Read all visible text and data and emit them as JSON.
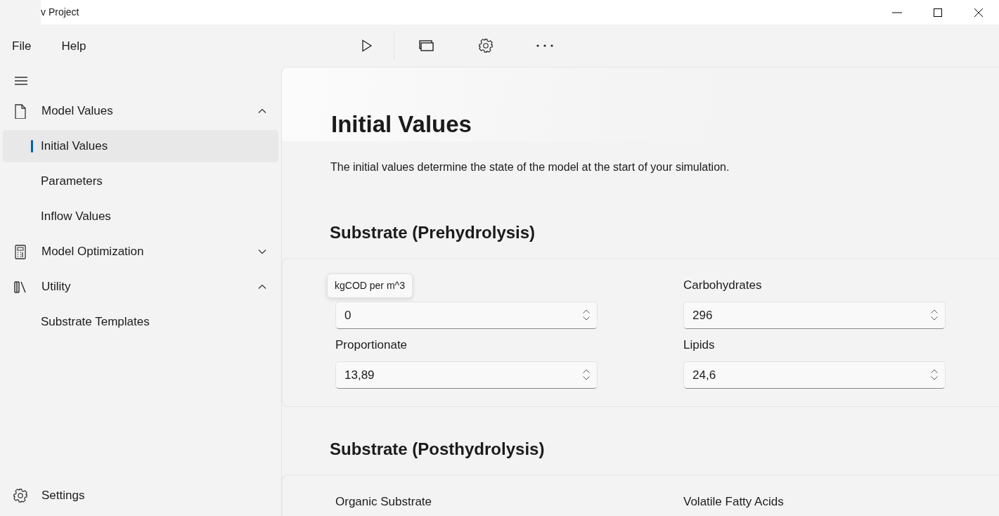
{
  "window": {
    "title": "v Project"
  },
  "menu": [
    "File",
    "Help"
  ],
  "nav": {
    "items": [
      {
        "label": "Model Values",
        "expanded": true,
        "children": [
          {
            "label": "Initial Values",
            "selected": true
          },
          {
            "label": "Parameters",
            "selected": false
          },
          {
            "label": "Inflow Values",
            "selected": false
          }
        ]
      },
      {
        "label": "Model Optimization",
        "expanded": false
      },
      {
        "label": "Utility",
        "expanded": true,
        "children": [
          {
            "label": "Substrate Templates",
            "selected": false
          }
        ]
      }
    ],
    "footer": "Settings"
  },
  "page": {
    "title": "Initial Values",
    "description": "The initial values determine the state of the model at the start of your simulation.",
    "sections": [
      {
        "heading": "Substrate (Prehydrolysis)",
        "fields": [
          {
            "tooltip": "kgCOD per m^3",
            "value": "0"
          },
          {
            "label": "Carbohydrates",
            "value": "296"
          },
          {
            "label": "Proportionate",
            "value": "13,89"
          },
          {
            "label": "Lipids",
            "value": "24,6"
          }
        ]
      },
      {
        "heading": "Substrate (Posthydrolysis)",
        "fields": [
          {
            "label": "Organic Substrate"
          },
          {
            "label": "Volatile Fatty Acids"
          }
        ]
      }
    ]
  }
}
